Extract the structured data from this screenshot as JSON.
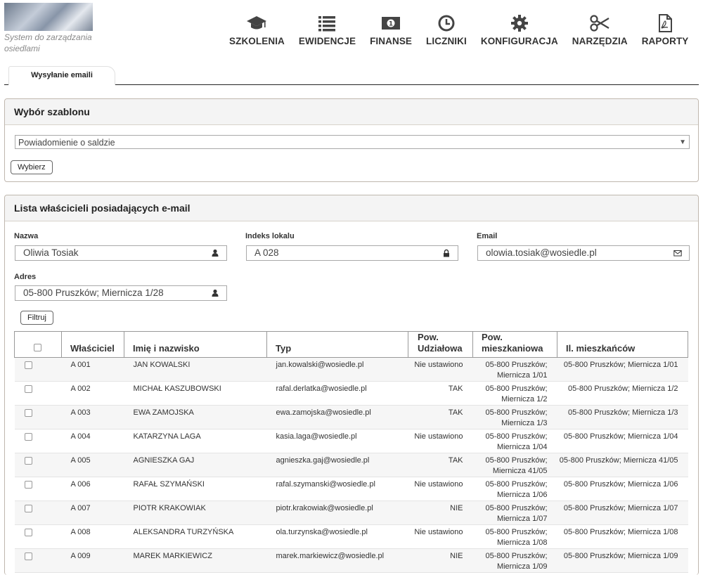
{
  "app": {
    "subtitle": "System do zarządzania osiedlami"
  },
  "nav": [
    {
      "label": "SZKOLENIA",
      "icon": "graduation-cap-icon"
    },
    {
      "label": "EWIDENCJE",
      "icon": "list-icon"
    },
    {
      "label": "FINANSE",
      "icon": "money-icon"
    },
    {
      "label": "LICZNIKI",
      "icon": "clock-icon"
    },
    {
      "label": "KONFIGURACJA",
      "icon": "gear-icon"
    },
    {
      "label": "NARZĘDZIA",
      "icon": "scissors-icon"
    },
    {
      "label": "RAPORTY",
      "icon": "pdf-file-icon"
    }
  ],
  "tabs": {
    "active": "Wysyłanie emaili"
  },
  "template_panel": {
    "title": "Wybór szablonu",
    "selected_template": "Powiadomienie o saldzie",
    "choose_button": "Wybierz"
  },
  "owners_panel": {
    "title": "Lista właścicieli posiadających e-mail",
    "filters": {
      "name_label": "Nazwa",
      "name_value": "Oliwia Tosiak",
      "name_icon": "user-icon",
      "index_label": "Indeks lokalu",
      "index_value": "A 028",
      "index_icon": "lock-icon",
      "email_label": "Email",
      "email_value": "olowia.tosiak@wosiedle.pl",
      "email_icon": "envelope-icon",
      "address_label": "Adres",
      "address_value": "05-800 Pruszków; Miernicza 1/28",
      "address_icon": "user-icon"
    },
    "filter_button": "Filtruj",
    "columns": [
      "Właściciel",
      "Imię i nazwisko",
      "Typ",
      "Pow. Udziałowa",
      "Pow. mieszkaniowa",
      "Il. mieszkańców"
    ],
    "rows": [
      {
        "owner": "A 001",
        "name": "JAN KOWALSKI",
        "email": "jan.kowalski@wosiedle.pl",
        "share": "Nie ustawiono",
        "residential": "05-800 Pruszków; Miernicza 1/01",
        "residents": "05-800 Pruszków; Miernicza 1/01"
      },
      {
        "owner": "A 002",
        "name": "MICHAŁ KASZUBOWSKI",
        "email": "rafal.derlatka@wosiedle.pl",
        "share": "TAK",
        "residential": "05-800 Pruszków; Miernicza 1/2",
        "residents": "05-800 Pruszków; Miernicza 1/2"
      },
      {
        "owner": "A 003",
        "name": "EWA ZAMOJSKA",
        "email": "ewa.zamojska@wosiedle.pl",
        "share": "TAK",
        "residential": "05-800 Pruszków; Miernicza 1/3",
        "residents": "05-800 Pruszków; Miernicza 1/3"
      },
      {
        "owner": "A 004",
        "name": "KATARZYNA LAGA",
        "email": "kasia.laga@wosiedle.pl",
        "share": "Nie ustawiono",
        "residential": "05-800 Pruszków; Miernicza 1/04",
        "residents": "05-800 Pruszków; Miernicza 1/04"
      },
      {
        "owner": "A 005",
        "name": "AGNIESZKA GAJ",
        "email": "agnieszka.gaj@wosiedle.pl",
        "share": "TAK",
        "residential": "05-800 Pruszków; Miernicza 41/05",
        "residents": "05-800 Pruszków; Miernicza 41/05"
      },
      {
        "owner": "A 006",
        "name": "RAFAŁ SZYMAŃSKI",
        "email": "rafal.szymanski@wosiedle.pl",
        "share": "Nie ustawiono",
        "residential": "05-800 Pruszków; Miernicza 1/06",
        "residents": "05-800 Pruszków; Miernicza 1/06"
      },
      {
        "owner": "A 007",
        "name": "PIOTR KRAKOWIAK",
        "email": "piotr.krakowiak@wosiedle.pl",
        "share": "NIE",
        "residential": "05-800 Pruszków; Miernicza 1/07",
        "residents": "05-800 Pruszków; Miernicza 1/07"
      },
      {
        "owner": "A 008",
        "name": "ALEKSANDRA TURZYŃSKA",
        "email": "ola.turzynska@wosiedle.pl",
        "share": "Nie ustawiono",
        "residential": "05-800 Pruszków; Miernicza 1/08",
        "residents": "05-800 Pruszków; Miernicza 1/08"
      },
      {
        "owner": "A 009",
        "name": "MAREK MARKIEWICZ",
        "email": "marek.markiewicz@wosiedle.pl",
        "share": "NIE",
        "residential": "05-800 Pruszków; Miernicza 1/09",
        "residents": "05-800 Pruszków; Miernicza 1/09"
      }
    ]
  }
}
